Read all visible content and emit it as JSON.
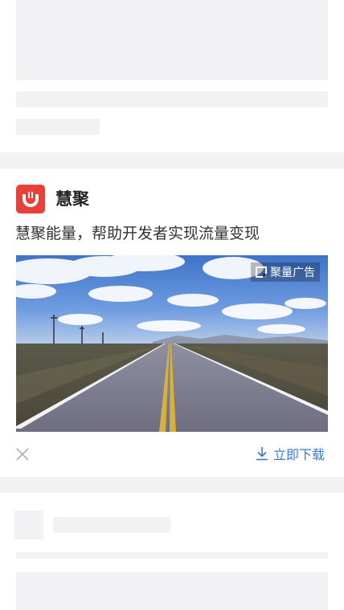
{
  "ad": {
    "brand_name": "慧聚",
    "description": "慧聚能量，帮助开发者实现流量变现",
    "badge_label": "聚量广告",
    "download_label": "立即下载",
    "logo_icon": "hui-ju-logo-icon",
    "close_icon": "close-icon",
    "download_icon": "download-icon",
    "accent_color": "#3a79d8",
    "logo_color": "#e8413a"
  }
}
